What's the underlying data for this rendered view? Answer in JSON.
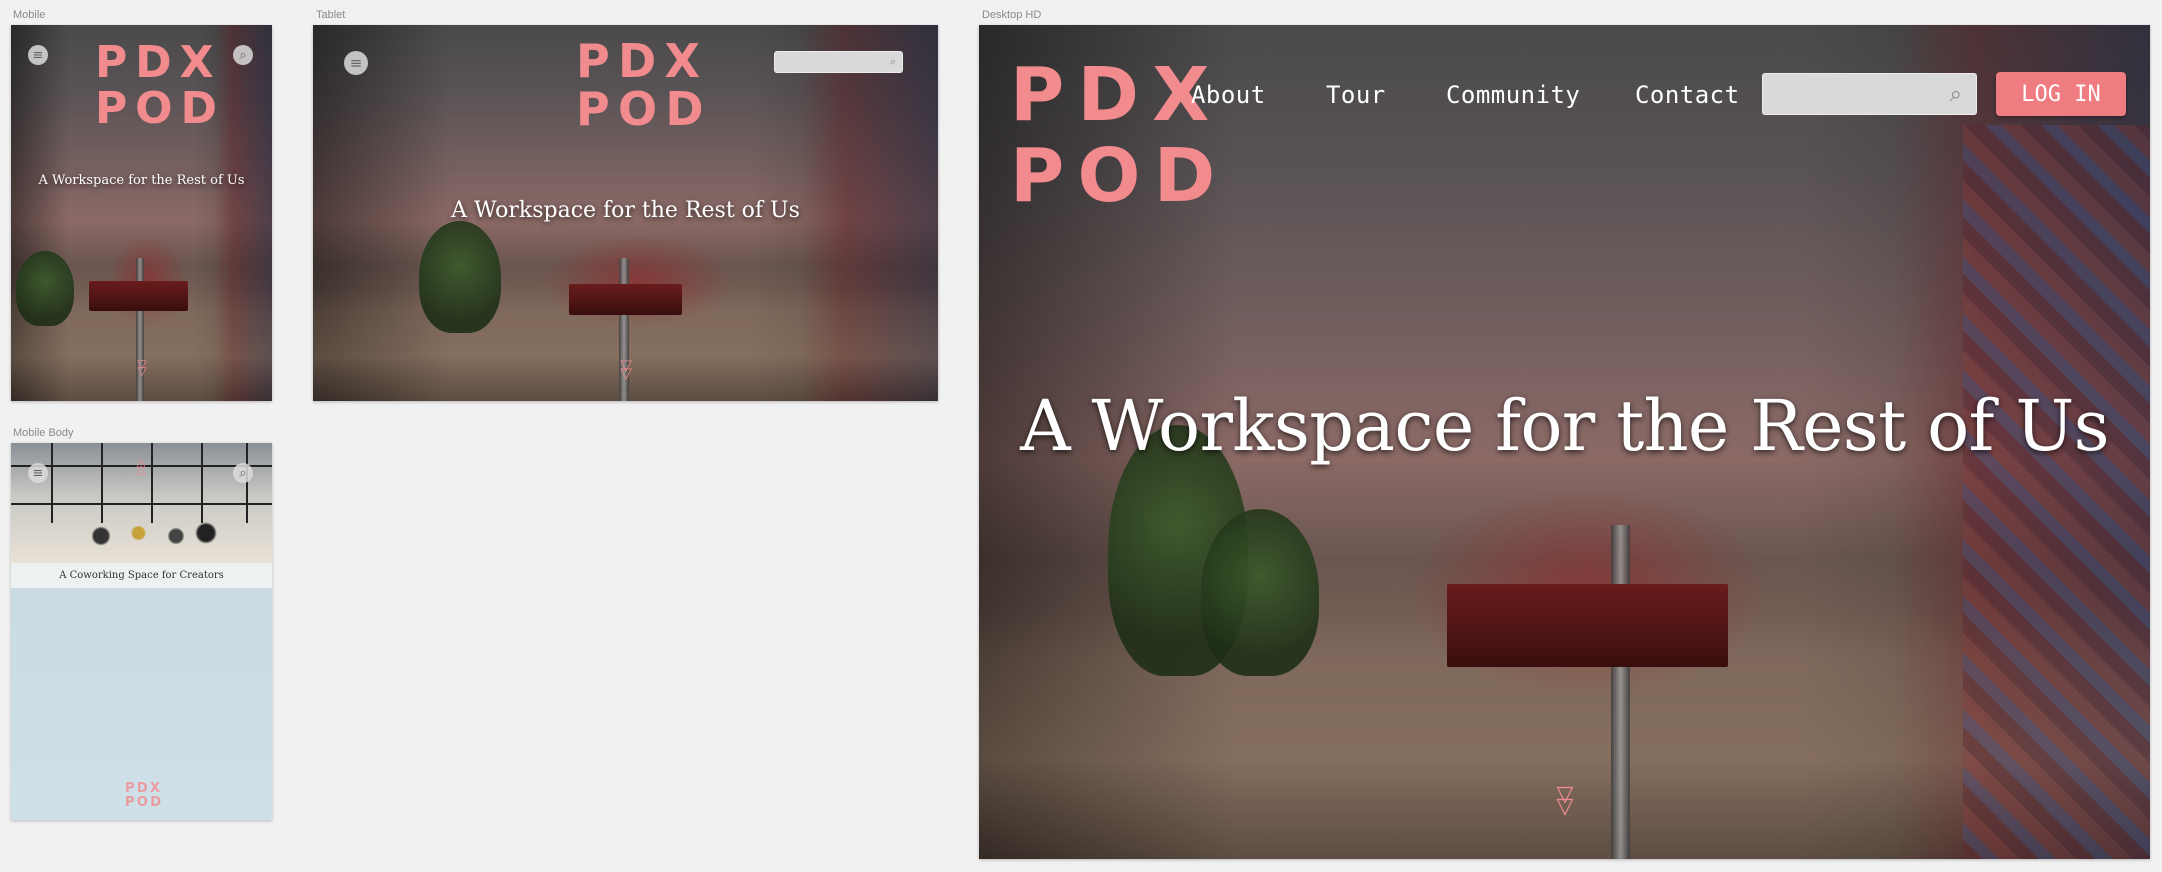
{
  "labels": {
    "mobile": "Mobile",
    "tablet": "Tablet",
    "desktop": "Desktop HD",
    "mobile_body": "Mobile Body"
  },
  "logo": {
    "line1": "PDX",
    "line2": "POD"
  },
  "tagline": "A Workspace for the Rest of Us",
  "mobile_body": {
    "caption": "A Coworking Space for Creators"
  },
  "nav": {
    "items": [
      "About",
      "Tour",
      "Community",
      "Contact"
    ],
    "login_label": "LOG IN"
  },
  "icons": {
    "menu": "≡",
    "search": "⌕",
    "scroll_down": "double-chevron-down-icon"
  },
  "colors": {
    "brand": "#f28b8e",
    "login_bg": "#ef7c80",
    "canvas": "#f1f1f1",
    "body_bg": "#c9dce6"
  }
}
